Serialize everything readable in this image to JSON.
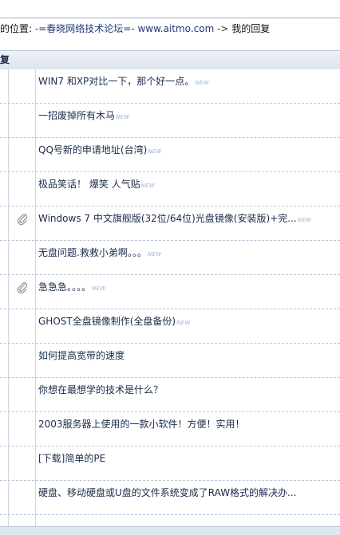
{
  "breadcrumb": {
    "prefix": "的位置: ",
    "forum": "-=春晓网络技术论坛=- www.aitmo.com",
    "separator": " -> ",
    "current": "我的回复"
  },
  "header": {
    "title": "复"
  },
  "new_badge": "NEW",
  "topics": [
    {
      "title": "WIN7 和XP对比一下，那个好一点。",
      "new": true,
      "attachment": false
    },
    {
      "title": "一招废掉所有木马",
      "new": true,
      "attachment": false
    },
    {
      "title": "QQ号新的申请地址(台湾)",
      "new": true,
      "attachment": false
    },
    {
      "title": "极品笑话！ 爆笑 人气贴",
      "new": true,
      "attachment": false
    },
    {
      "title": "Windows 7 中文旗舰版(32位/64位)光盘镜像(安装版)+完...",
      "new": true,
      "attachment": true
    },
    {
      "title": "无盘问题.救救小弟啊。。。",
      "new": true,
      "attachment": false
    },
    {
      "title": "急急急。。。。",
      "new": true,
      "attachment": true
    },
    {
      "title": "GHOST全盘镜像制作(全盘备份)",
      "new": true,
      "attachment": false
    },
    {
      "title": "如何提高宽带的速度",
      "new": false,
      "attachment": false
    },
    {
      "title": "你想在最想学的技术是什么？",
      "new": false,
      "attachment": false
    },
    {
      "title": "2003服务器上使用的一款小软件！方便！实用！",
      "new": false,
      "attachment": false
    },
    {
      "title": "[下载]简单的PE",
      "new": false,
      "attachment": false
    },
    {
      "title": "硬盘、移动硬盘或U盘的文件系统变成了RAW格式的解决办...",
      "new": false,
      "attachment": false
    }
  ]
}
